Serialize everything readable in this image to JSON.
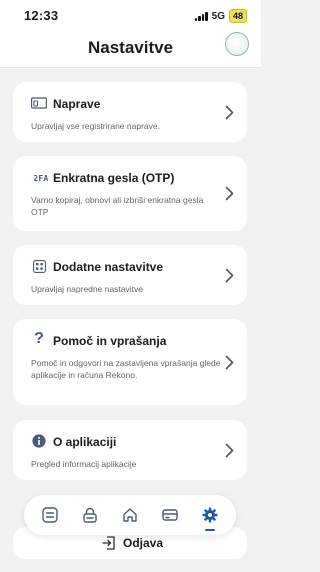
{
  "status": {
    "time": "12:33",
    "network": "5G",
    "battery": "48"
  },
  "header": {
    "title": "Nastavitve"
  },
  "cards": [
    {
      "icon": "devices-icon",
      "title": "Naprave",
      "description": "Upravljaj vse registrirane naprave."
    },
    {
      "icon": "2fa-icon",
      "icon_text": "2FA",
      "title": "Enkratna gesla (OTP)",
      "description": "Varno kopiraj, obnovi ali izbriši enkratna gesla OTP"
    },
    {
      "icon": "grid-settings-icon",
      "title": "Dodatne nastavitve",
      "description": "Upravljaj napredne nastavitve"
    },
    {
      "icon": "question-icon",
      "icon_text": "?",
      "title": "Pomoč in vprašanja",
      "description": "Pomoč in odgovori na zastavljena vprašanja glede aplikacije in računa Rekono."
    },
    {
      "icon": "info-icon",
      "title": "O aplikaciji",
      "description": "Pregled informacij aplikacije"
    }
  ],
  "logout": {
    "label": "Odjava"
  },
  "nav": {
    "items": [
      "list-icon",
      "lock-icon",
      "home-icon",
      "card-icon",
      "gear-icon"
    ],
    "active": "gear-icon"
  },
  "colors": {
    "accent": "#1e5aa0",
    "background": "#f2f2f4",
    "card": "#ffffff",
    "battery": "#f3e14e"
  }
}
